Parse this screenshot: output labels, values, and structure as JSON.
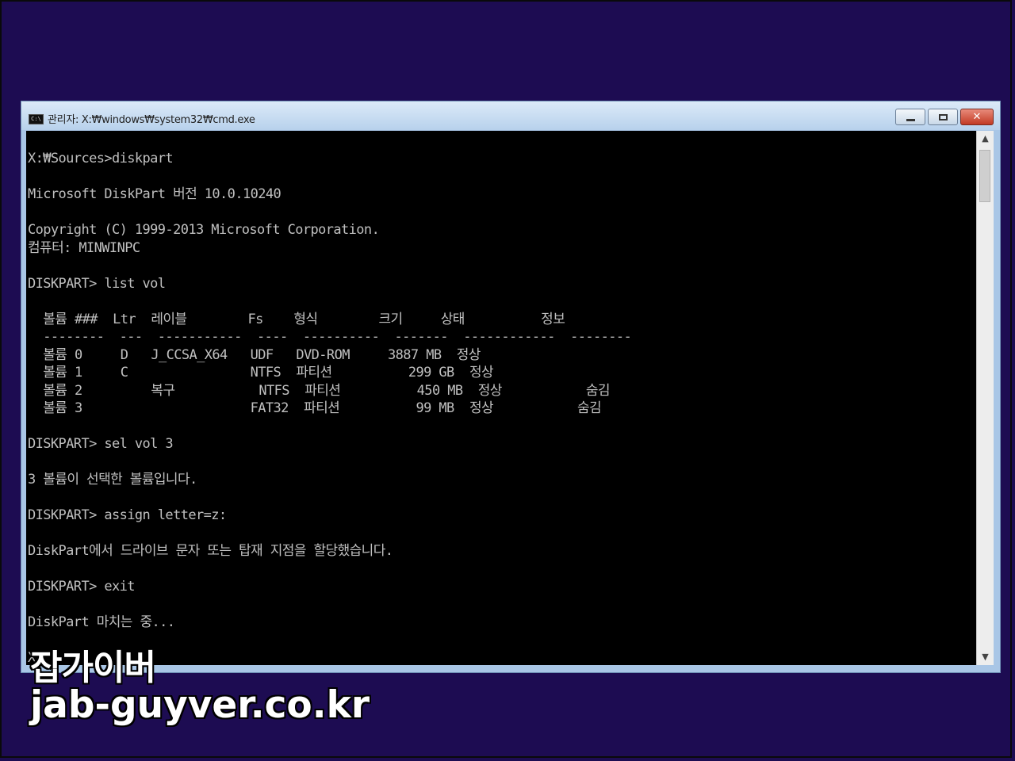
{
  "window": {
    "title": "관리자: X:₩windows₩system32₩cmd.exe",
    "icon": "console-app-icon"
  },
  "console": {
    "lines": [
      "X:₩Sources>diskpart",
      "",
      "Microsoft DiskPart 버전 10.0.10240",
      "",
      "Copyright (C) 1999-2013 Microsoft Corporation.",
      "컴퓨터: MINWINPC",
      "",
      "DISKPART> list vol",
      "",
      "  볼륨 ###  Ltr  레이블        Fs    형식        크기     상태          정보",
      "  --------  ---  -----------  ----  ----------  -------  ------------  --------",
      "  볼륨 0     D   J_CCSA_X64   UDF   DVD-ROM     3887 MB  정상",
      "  볼륨 1     C                NTFS  파티션          299 GB  정상",
      "  볼륨 2         복구           NTFS  파티션          450 MB  정상           숨김",
      "  볼륨 3                      FAT32  파티션          99 MB  정상           숨김",
      "",
      "DISKPART> sel vol 3",
      "",
      "3 볼륨이 선택한 볼륨입니다.",
      "",
      "DISKPART> assign letter=z:",
      "",
      "DiskPart에서 드라이브 문자 또는 탑재 지점을 할당했습니다.",
      "",
      "DISKPART> exit",
      "",
      "DiskPart 마치는 중...",
      "",
      "X:"
    ]
  },
  "watermark": {
    "name": "잡가이버",
    "url": "jab-guyver.co.kr"
  },
  "colors": {
    "desktop": "#1d0c52",
    "console_bg": "#000000",
    "console_text": "#c0c0c0",
    "window_frame": "#a9c6e6"
  }
}
